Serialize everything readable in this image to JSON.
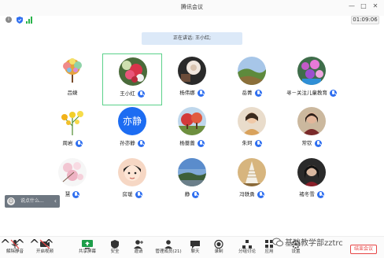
{
  "window": {
    "title": "腾讯会议",
    "controls": {
      "minimize": "—",
      "maximize": "□",
      "close": "✕"
    }
  },
  "infobar": {
    "timer": "01:09:06"
  },
  "speaking": "正在讲话: 王小红;",
  "participants": [
    {
      "name": "吕婕",
      "mic": false,
      "avatar": "tree",
      "selected": false
    },
    {
      "name": "王小红",
      "mic": true,
      "avatar": "flowers-red",
      "selected": true
    },
    {
      "name": "杨伟娜",
      "mic": true,
      "avatar": "dark-flower",
      "selected": false
    },
    {
      "name": "岳菁",
      "mic": true,
      "avatar": "landscape-green",
      "selected": false
    },
    {
      "name": "寻－关注儿童教育",
      "mic": true,
      "avatar": "purple-flowers",
      "selected": false
    },
    {
      "name": "周岩",
      "mic": true,
      "avatar": "yellow-flowers",
      "selected": false
    },
    {
      "name": "孙亦静",
      "mic": true,
      "avatar": "text",
      "avatar_text": "亦静",
      "selected": false
    },
    {
      "name": "杨蔷蔷",
      "mic": true,
      "avatar": "red-tree",
      "selected": false
    },
    {
      "name": "朱珂",
      "mic": true,
      "avatar": "woman-photo",
      "selected": false
    },
    {
      "name": "常钦",
      "mic": true,
      "avatar": "person-photo",
      "selected": false
    },
    {
      "name": "慧",
      "mic": true,
      "avatar": "pink-blossom",
      "selected": false
    },
    {
      "name": "房瑗",
      "mic": true,
      "avatar": "cartoon-girl",
      "selected": false
    },
    {
      "name": "静",
      "mic": true,
      "avatar": "sky-landscape",
      "selected": false
    },
    {
      "name": "冯轶勇",
      "mic": true,
      "avatar": "tower",
      "selected": false
    },
    {
      "name": "褚冬雪",
      "mic": true,
      "avatar": "dark-girl",
      "selected": false
    }
  ],
  "chat": {
    "placeholder": "说点什么...",
    "collapse": "‹"
  },
  "toolbar": {
    "items": [
      {
        "label": "解除静音",
        "icon": "mic-muted-icon"
      },
      {
        "label": "开启视频",
        "icon": "camera-off-icon"
      },
      {
        "label": "共享屏幕",
        "icon": "screen-share-icon"
      },
      {
        "label": "安全",
        "icon": "shield-icon"
      },
      {
        "label": "邀请",
        "icon": "invite-icon"
      },
      {
        "label": "管理成员(21)",
        "icon": "members-icon"
      },
      {
        "label": "聊天",
        "icon": "chat-icon"
      },
      {
        "label": "录制",
        "icon": "record-icon"
      },
      {
        "label": "分组讨论",
        "icon": "breakout-icon"
      },
      {
        "label": "应用",
        "icon": "apps-icon"
      },
      {
        "label": "设置",
        "icon": "settings-icon"
      }
    ],
    "leave_label": "结束会议"
  },
  "watermark": "基础教学部zztrc",
  "colors": {
    "accent": "#2f6ff0",
    "leave": "#e64545",
    "selected_border": "#5bd18a",
    "speaking_bg": "#dce9f8"
  }
}
